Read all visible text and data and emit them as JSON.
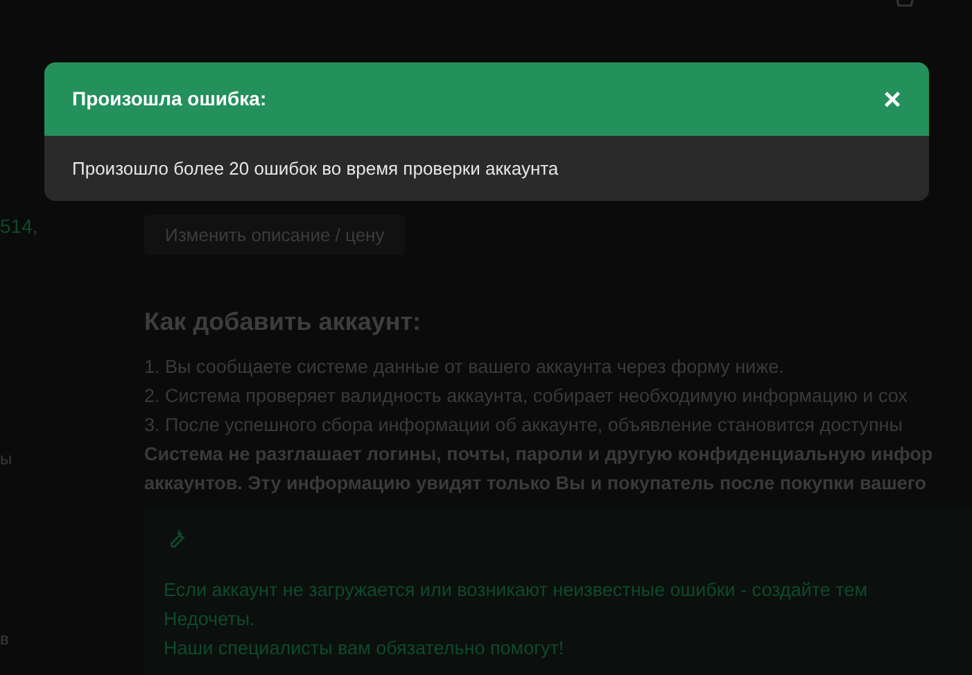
{
  "side_fragments": {
    "amount": "514,",
    "item_a": "ы",
    "item_b": "в"
  },
  "edit_button": "Изменить описание / цену",
  "howto": {
    "title": "Как добавить аккаунт:",
    "steps": [
      "1. Вы сообщаете системе данные от вашего аккаунта через форму ниже.",
      "2. Система проверяет валидность аккаунта, собирает необходимую информацию и сох",
      "3. После успешного сбора информации об аккаунте, объявление становится доступны"
    ],
    "notice_lines": [
      "Система не разглашает логины, почты, пароли и другую конфиденциальную инфор",
      "аккаунтов. Эту информацию увидят только Вы и покупатель после покупки вашего"
    ]
  },
  "help_box": {
    "lines": [
      "Если аккаунт не загружается или возникают неизвестные ошибки - создайте тем",
      "Недочеты.",
      "Наши специалисты вам обязательно помогут!"
    ]
  },
  "modal": {
    "title": "Произошла ошибка:",
    "close": "×",
    "message": "Произошло более 20 ошибок во время проверки аккаунта"
  }
}
